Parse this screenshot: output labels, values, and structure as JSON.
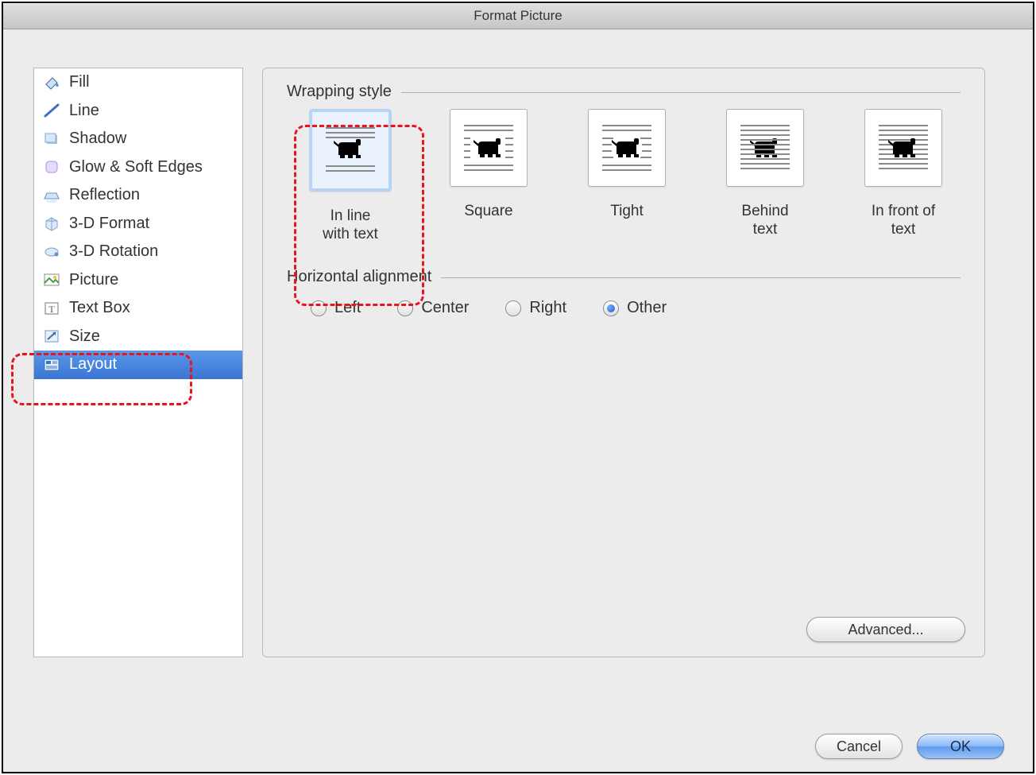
{
  "window": {
    "title": "Format Picture"
  },
  "sidebar": {
    "items": [
      {
        "name": "fill",
        "label": "Fill",
        "icon": "paintbucket-icon"
      },
      {
        "name": "line",
        "label": "Line",
        "icon": "line-icon"
      },
      {
        "name": "shadow",
        "label": "Shadow",
        "icon": "shadow-icon"
      },
      {
        "name": "glow",
        "label": "Glow & Soft Edges",
        "icon": "glow-icon"
      },
      {
        "name": "reflection",
        "label": "Reflection",
        "icon": "reflection-icon"
      },
      {
        "name": "3d-format",
        "label": "3-D Format",
        "icon": "cube-icon"
      },
      {
        "name": "3d-rotation",
        "label": "3-D Rotation",
        "icon": "rotation-icon"
      },
      {
        "name": "picture",
        "label": "Picture",
        "icon": "picture-icon"
      },
      {
        "name": "text-box",
        "label": "Text Box",
        "icon": "textbox-icon"
      },
      {
        "name": "size",
        "label": "Size",
        "icon": "resize-icon"
      },
      {
        "name": "layout",
        "label": "Layout",
        "icon": "layout-icon",
        "selected": true
      }
    ]
  },
  "layout_tab": {
    "wrapping_label": "Wrapping style",
    "styles": [
      {
        "name": "inline",
        "label": "In line\nwith text",
        "selected": true
      },
      {
        "name": "square",
        "label": "Square"
      },
      {
        "name": "tight",
        "label": "Tight"
      },
      {
        "name": "behind",
        "label": "Behind\ntext"
      },
      {
        "name": "front",
        "label": "In front of\ntext"
      }
    ],
    "h_align_label": "Horizontal alignment",
    "alignment_options": [
      {
        "name": "left",
        "label": "Left",
        "checked": false
      },
      {
        "name": "center",
        "label": "Center",
        "checked": false
      },
      {
        "name": "right",
        "label": "Right",
        "checked": false
      },
      {
        "name": "other",
        "label": "Other",
        "checked": true
      }
    ],
    "advanced_label": "Advanced..."
  },
  "buttons": {
    "cancel": "Cancel",
    "ok": "OK"
  }
}
